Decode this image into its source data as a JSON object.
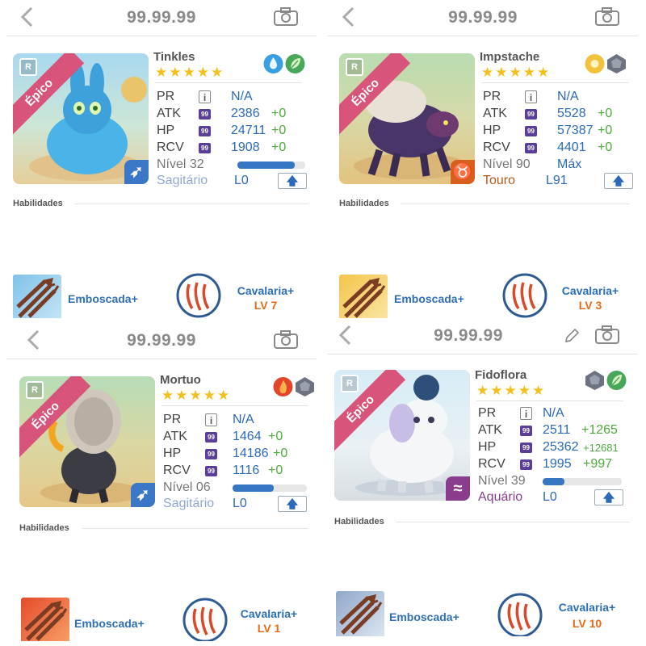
{
  "panels": [
    {
      "header_title": "99.99.99",
      "rarity": "Épico",
      "rarity_badge": "R",
      "name": "Tinkles",
      "stars": "★★★★★",
      "elements": [
        "water-drop-icon",
        "leaf-icon"
      ],
      "pr_label": "PR",
      "pr_badge": "i",
      "pr_value": "N/A",
      "atk_label": "ATK",
      "atk": "2386",
      "atk_plus": "+0",
      "hp_label": "HP",
      "hp": "24711",
      "hp_plus": "+0",
      "rcv_label": "RCV",
      "rcv": "1908",
      "rcv_plus": "+0",
      "stat_badge": "99",
      "level_label": "Nível 32",
      "level_progress": 0.85,
      "zodiac": "Sagitário",
      "zodiac_symbol": "➶",
      "lock_level": "L0",
      "upgrade_icon": "🡅",
      "abilities_title": "Habilidades",
      "skill1": "Emboscada+",
      "skill2": "Cavalaria+",
      "skill2_level": "LV 7",
      "accent": "#3a77c6"
    },
    {
      "header_title": "99.99.99",
      "rarity": "Épico",
      "rarity_badge": "R",
      "name": "Impstache",
      "stars": "★★★★★",
      "elements": [
        "sun-icon",
        "rock-icon"
      ],
      "pr_label": "PR",
      "pr_badge": "i",
      "pr_value": "N/A",
      "atk_label": "ATK",
      "atk": "5528",
      "atk_plus": "+0",
      "hp_label": "HP",
      "hp": "57387",
      "hp_plus": "+0",
      "rcv_label": "RCV",
      "rcv": "4401",
      "rcv_plus": "+0",
      "stat_badge": "99",
      "level_label": "Nível 90",
      "level_max": "Máx",
      "zodiac": "Touro",
      "zodiac_symbol": "♉",
      "lock_level": "L91",
      "upgrade_icon": "🡅",
      "abilities_title": "Habilidades",
      "skill1": "Emboscada+",
      "skill2": "Cavalaria+",
      "skill2_level": "LV 3",
      "accent": "#d95f1e"
    },
    {
      "header_title": "99.99.99",
      "rarity": "Épico",
      "rarity_badge": "R",
      "name": "Mortuo",
      "stars": "★★★★★",
      "elements": [
        "fire-icon",
        "rock-icon"
      ],
      "pr_label": "PR",
      "pr_badge": "i",
      "pr_value": "N/A",
      "atk_label": "ATK",
      "atk": "1464",
      "atk_plus": "+0",
      "hp_label": "HP",
      "hp": "14186",
      "hp_plus": "+0",
      "rcv_label": "RCV",
      "rcv": "1116",
      "rcv_plus": "+0",
      "stat_badge": "99",
      "level_label": "Nível 06",
      "level_progress": 0.55,
      "zodiac": "Sagitário",
      "zodiac_symbol": "➶",
      "lock_level": "L0",
      "upgrade_icon": "🡅",
      "abilities_title": "Habilidades",
      "skill1": "Emboscada+",
      "skill2": "Cavalaria+",
      "skill2_level": "LV 1",
      "accent": "#3a77c6"
    },
    {
      "header_title": "99.99.99",
      "rarity": "Épico",
      "rarity_badge": "R",
      "name": "Fidoflora",
      "stars": "★★★★★",
      "elements": [
        "rock-icon",
        "leaf-icon"
      ],
      "pr_label": "PR",
      "pr_badge": "i",
      "pr_value": "N/A",
      "atk_label": "ATK",
      "atk": "2511",
      "atk_plus": "+1265",
      "hp_label": "HP",
      "hp": "25362",
      "hp_plus": "+12681",
      "rcv_label": "RCV",
      "rcv": "1995",
      "rcv_plus": "+997",
      "stat_badge": "99",
      "level_label": "Nível 39",
      "level_progress": 0.28,
      "zodiac": "Aquário",
      "zodiac_symbol": "≈",
      "lock_level": "L0",
      "upgrade_icon": "🡅",
      "abilities_title": "Habilidades",
      "skill1": "Emboscada+",
      "skill2": "Cavalaria+",
      "skill2_level": "LV 10",
      "accent": "#8a3d8c"
    }
  ]
}
